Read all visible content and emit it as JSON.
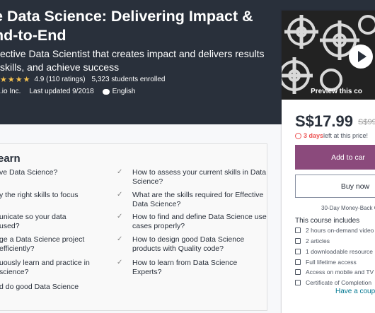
{
  "header": {
    "title_line1": "e Data Science: Delivering Impact &",
    "title_line2": "nd-to-End",
    "subtitle_line1": "ective Data Scientist that creates impact and delivers results",
    "subtitle_line2": "skills, and achieve success",
    "stars": "★★★★",
    "rating": "4.9 (110 ratings)",
    "enrolled": "5,323 students enrolled",
    "author": ".io Inc.",
    "updated": "Last updated 9/2018",
    "language": "English"
  },
  "learn": {
    "title": "earn",
    "left": [
      "ve Data Science?",
      "y the right skills to focus",
      "unicate so your data\nused?",
      "ge a Data Science project\nefficiently?",
      "uously learn and practice in\nscience?",
      "d do good Data Science"
    ],
    "right": [
      "How to assess your current skills in Data\nScience?",
      "What are the skills required for Effective\nData Science?",
      "How to find and define Data Science use\ncases properly?",
      "How to design good Data Science\nproducts with Quality code?",
      "How to learn from Data Science Experts?"
    ]
  },
  "sidebar": {
    "preview_label": "Preview this co",
    "price": "S$17.99",
    "old_price": "S$99",
    "days_bold": "3 days",
    "days_rest": " left at this price!",
    "add_to_cart": "Add to car",
    "buy_now": "Buy now",
    "moneyback": "30-Day Money-Back G",
    "includes_title": "This course includes",
    "includes": [
      "2 hours on-demand video",
      "2 articles",
      "1 downloadable resource",
      "Full lifetime access",
      "Access on mobile and TV",
      "Certificate of Completion"
    ],
    "coupon": "Have a coupo"
  }
}
